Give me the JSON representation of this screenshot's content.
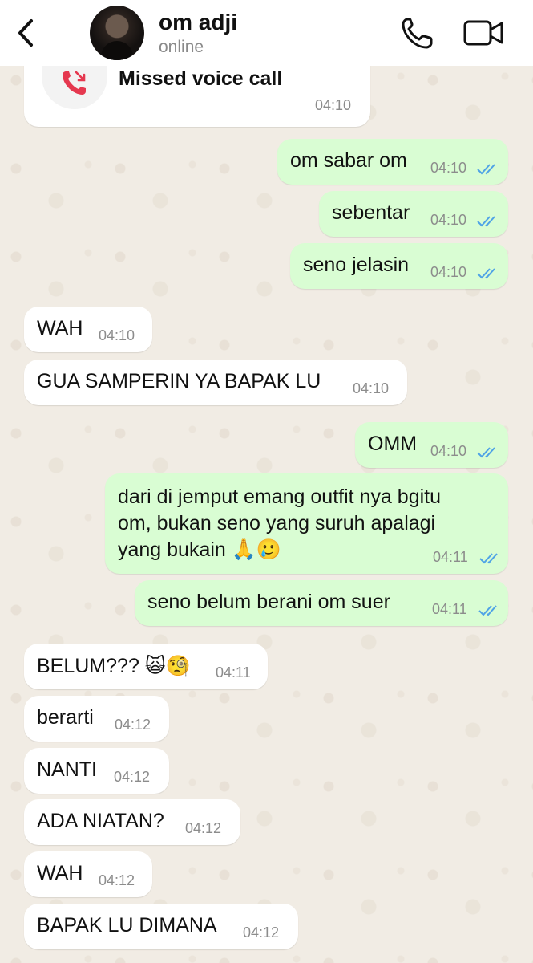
{
  "header": {
    "contact_name": "om adji",
    "status": "online"
  },
  "missed_call": {
    "label": "Missed voice call",
    "time": "04:10"
  },
  "messages": [
    {
      "dir": "out",
      "text": "om sabar om",
      "time": "04:10"
    },
    {
      "dir": "out",
      "text": "sebentar",
      "time": "04:10"
    },
    {
      "dir": "out",
      "text": "seno jelasin",
      "time": "04:10"
    },
    {
      "dir": "in",
      "text": "WAH",
      "time": "04:10"
    },
    {
      "dir": "in",
      "text": "GUA SAMPERIN YA BAPAK LU",
      "time": "04:10"
    },
    {
      "dir": "out",
      "text": "OMM",
      "time": "04:10"
    },
    {
      "dir": "out",
      "lines": [
        "dari di jemput emang outfit nya bgitu",
        "om, bukan seno yang suruh apalagi",
        "yang bukain 🙏🥲"
      ],
      "time": "04:11"
    },
    {
      "dir": "out",
      "text": "seno belum berani om suer",
      "time": "04:11"
    },
    {
      "dir": "in",
      "text": "BELUM??? 🙀🧐",
      "time": "04:11"
    },
    {
      "dir": "in",
      "text": "berarti",
      "time": "04:12"
    },
    {
      "dir": "in",
      "text": "NANTI",
      "time": "04:12"
    },
    {
      "dir": "in",
      "text": "ADA NIATAN?",
      "time": "04:12"
    },
    {
      "dir": "in",
      "text": "WAH",
      "time": "04:12"
    },
    {
      "dir": "in",
      "text": "BAPAK LU DIMANA",
      "time": "04:12"
    }
  ],
  "colors": {
    "outgoing_bubble": "#d9fdd3",
    "incoming_bubble": "#ffffff",
    "read_tick": "#4fa3e6",
    "missed_call_red": "#e5384f"
  },
  "icons": [
    "back-chevron-icon",
    "phone-icon",
    "video-camera-icon",
    "missed-call-icon",
    "double-check-icon"
  ]
}
